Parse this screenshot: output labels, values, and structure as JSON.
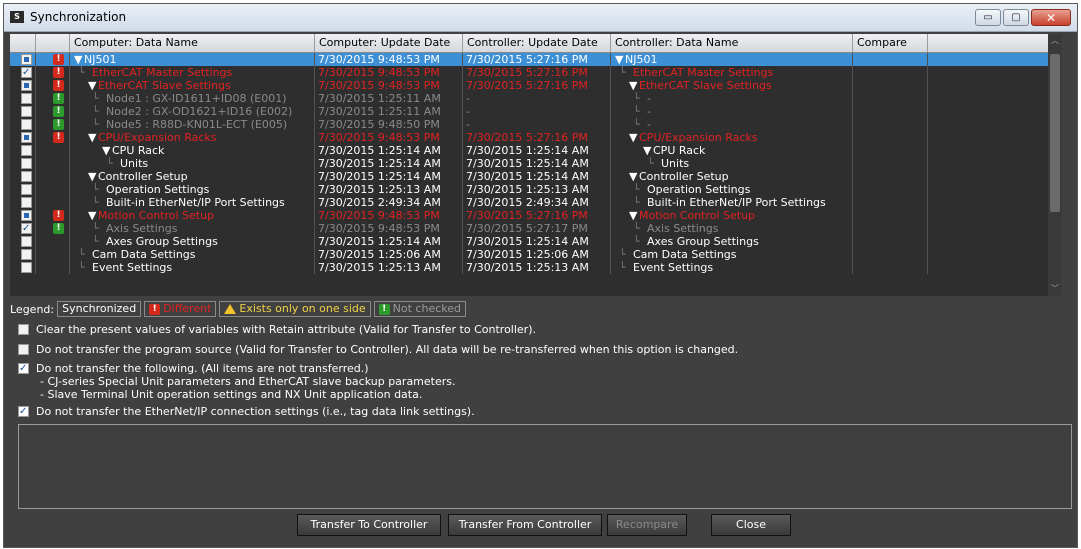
{
  "window": {
    "title": "Synchronization",
    "minimize": "▭",
    "maximize": "▢",
    "close": "✕"
  },
  "grid": {
    "columns": [
      "Computer: Data Name",
      "Computer: Update Date",
      "Controller: Update Date",
      "Controller: Data Name",
      "Compare"
    ],
    "rows": [
      {
        "check": "part",
        "status": "red",
        "indent": 0,
        "expander": "▼",
        "name": "NJ501",
        "cdate": "7/30/2015 9:48:53 PM",
        "kdate": "7/30/2015 5:27:16 PM",
        "kname": "NJ501",
        "kexp": "▼",
        "color": "white",
        "selected": true
      },
      {
        "check": "on",
        "status": "red",
        "indent": 1,
        "expander": "",
        "name": "EtherCAT Master Settings",
        "cdate": "7/30/2015 9:48:53 PM",
        "kdate": "7/30/2015 5:27:16 PM",
        "kname": "EtherCAT Master Settings",
        "kexp": "",
        "color": "red"
      },
      {
        "check": "part",
        "status": "red",
        "indent": 1,
        "expander": "▼",
        "name": "EtherCAT Slave Settings",
        "cdate": "7/30/2015 9:48:53 PM",
        "kdate": "7/30/2015 5:27:16 PM",
        "kname": "EtherCAT Slave Settings",
        "kexp": "▼",
        "color": "red"
      },
      {
        "check": "off",
        "status": "green",
        "indent": 2,
        "expander": "",
        "name": "Node1 : GX-ID1611+ID08 (E001)",
        "cdate": "7/30/2015 1:25:11 AM",
        "kdate": "-",
        "kname": "-",
        "kexp": "",
        "color": "gray"
      },
      {
        "check": "off",
        "status": "green",
        "indent": 2,
        "expander": "",
        "name": "Node2 : GX-OD1621+ID16 (E002)",
        "cdate": "7/30/2015 1:25:11 AM",
        "kdate": "-",
        "kname": "-",
        "kexp": "",
        "color": "gray"
      },
      {
        "check": "off",
        "status": "green",
        "indent": 2,
        "expander": "",
        "name": "Node5 : R88D-KN01L-ECT (E005)",
        "cdate": "7/30/2015 9:48:50 PM",
        "kdate": "-",
        "kname": "-",
        "kexp": "",
        "color": "gray"
      },
      {
        "check": "part",
        "status": "red",
        "indent": 1,
        "expander": "▼",
        "name": "CPU/Expansion Racks",
        "cdate": "7/30/2015 9:48:53 PM",
        "kdate": "7/30/2015 5:27:16 PM",
        "kname": "CPU/Expansion Racks",
        "kexp": "▼",
        "color": "red"
      },
      {
        "check": "off",
        "status": "",
        "indent": 2,
        "expander": "▼",
        "name": "CPU Rack",
        "cdate": "7/30/2015 1:25:14 AM",
        "kdate": "7/30/2015 1:25:14 AM",
        "kname": "CPU Rack",
        "kexp": "▼",
        "color": "white"
      },
      {
        "check": "off",
        "status": "",
        "indent": 3,
        "expander": "",
        "name": "Units",
        "cdate": "7/30/2015 1:25:14 AM",
        "kdate": "7/30/2015 1:25:14 AM",
        "kname": "Units",
        "kexp": "",
        "color": "white"
      },
      {
        "check": "off",
        "status": "",
        "indent": 1,
        "expander": "▼",
        "name": "Controller Setup",
        "cdate": "7/30/2015 1:25:14 AM",
        "kdate": "7/30/2015 1:25:14 AM",
        "kname": "Controller Setup",
        "kexp": "▼",
        "color": "white"
      },
      {
        "check": "off",
        "status": "",
        "indent": 2,
        "expander": "",
        "name": "Operation Settings",
        "cdate": "7/30/2015 1:25:13 AM",
        "kdate": "7/30/2015 1:25:13 AM",
        "kname": "Operation Settings",
        "kexp": "",
        "color": "white"
      },
      {
        "check": "off",
        "status": "",
        "indent": 2,
        "expander": "",
        "name": "Built-in EtherNet/IP Port Settings",
        "cdate": "7/30/2015 2:49:34 AM",
        "kdate": "7/30/2015 2:49:34 AM",
        "kname": "Built-in EtherNet/IP Port Settings",
        "kexp": "",
        "color": "white"
      },
      {
        "check": "part",
        "status": "red",
        "indent": 1,
        "expander": "▼",
        "name": "Motion Control Setup",
        "cdate": "7/30/2015 9:48:53 PM",
        "kdate": "7/30/2015 5:27:16 PM",
        "kname": "Motion Control Setup",
        "kexp": "▼",
        "color": "red"
      },
      {
        "check": "on",
        "status": "green",
        "indent": 2,
        "expander": "",
        "name": "Axis Settings",
        "cdate": "7/30/2015 9:48:53 PM",
        "kdate": "7/30/2015 5:27:17 PM",
        "kname": "Axis Settings",
        "kexp": "",
        "color": "gray"
      },
      {
        "check": "off",
        "status": "",
        "indent": 2,
        "expander": "",
        "name": "Axes Group Settings",
        "cdate": "7/30/2015 1:25:14 AM",
        "kdate": "7/30/2015 1:25:14 AM",
        "kname": "Axes Group Settings",
        "kexp": "",
        "color": "white"
      },
      {
        "check": "off",
        "status": "",
        "indent": 1,
        "expander": "",
        "name": "Cam Data Settings",
        "cdate": "7/30/2015 1:25:06 AM",
        "kdate": "7/30/2015 1:25:06 AM",
        "kname": "Cam Data Settings",
        "kexp": "",
        "color": "white"
      },
      {
        "check": "off",
        "status": "",
        "indent": 1,
        "expander": "",
        "name": "Event Settings",
        "cdate": "7/30/2015 1:25:13 AM",
        "kdate": "7/30/2015 1:25:13 AM",
        "kname": "Event Settings",
        "kexp": "",
        "color": "white"
      }
    ]
  },
  "legend": {
    "label": "Legend:",
    "synchronized": "Synchronized",
    "different": "Different",
    "one_side": "Exists only on one side",
    "not_checked": "Not checked"
  },
  "options": [
    {
      "checked": false,
      "text": "Clear the present values of variables with Retain attribute (Valid for Transfer to Controller)."
    },
    {
      "checked": false,
      "text": "Do not transfer the program source (Valid for Transfer to Controller). All data will be re-transferred when this option is changed."
    },
    {
      "checked": true,
      "text": "Do not transfer the following. (All items are not transferred.)",
      "sub1": "- CJ-series Special Unit parameters and EtherCAT slave backup parameters.",
      "sub2": "- Slave Terminal Unit operation settings and NX Unit application data."
    },
    {
      "checked": true,
      "text": "Do not transfer the EtherNet/IP connection settings (i.e., tag data link settings)."
    }
  ],
  "buttons": {
    "transfer_to": "Transfer To Controller",
    "transfer_from": "Transfer From Controller",
    "recompare": "Recompare",
    "close": "Close"
  },
  "colors": {
    "different": "#e02222",
    "synchronized": "#ffffff",
    "not_checked": "#8a8a8a",
    "selection": "#3d8fd6"
  }
}
